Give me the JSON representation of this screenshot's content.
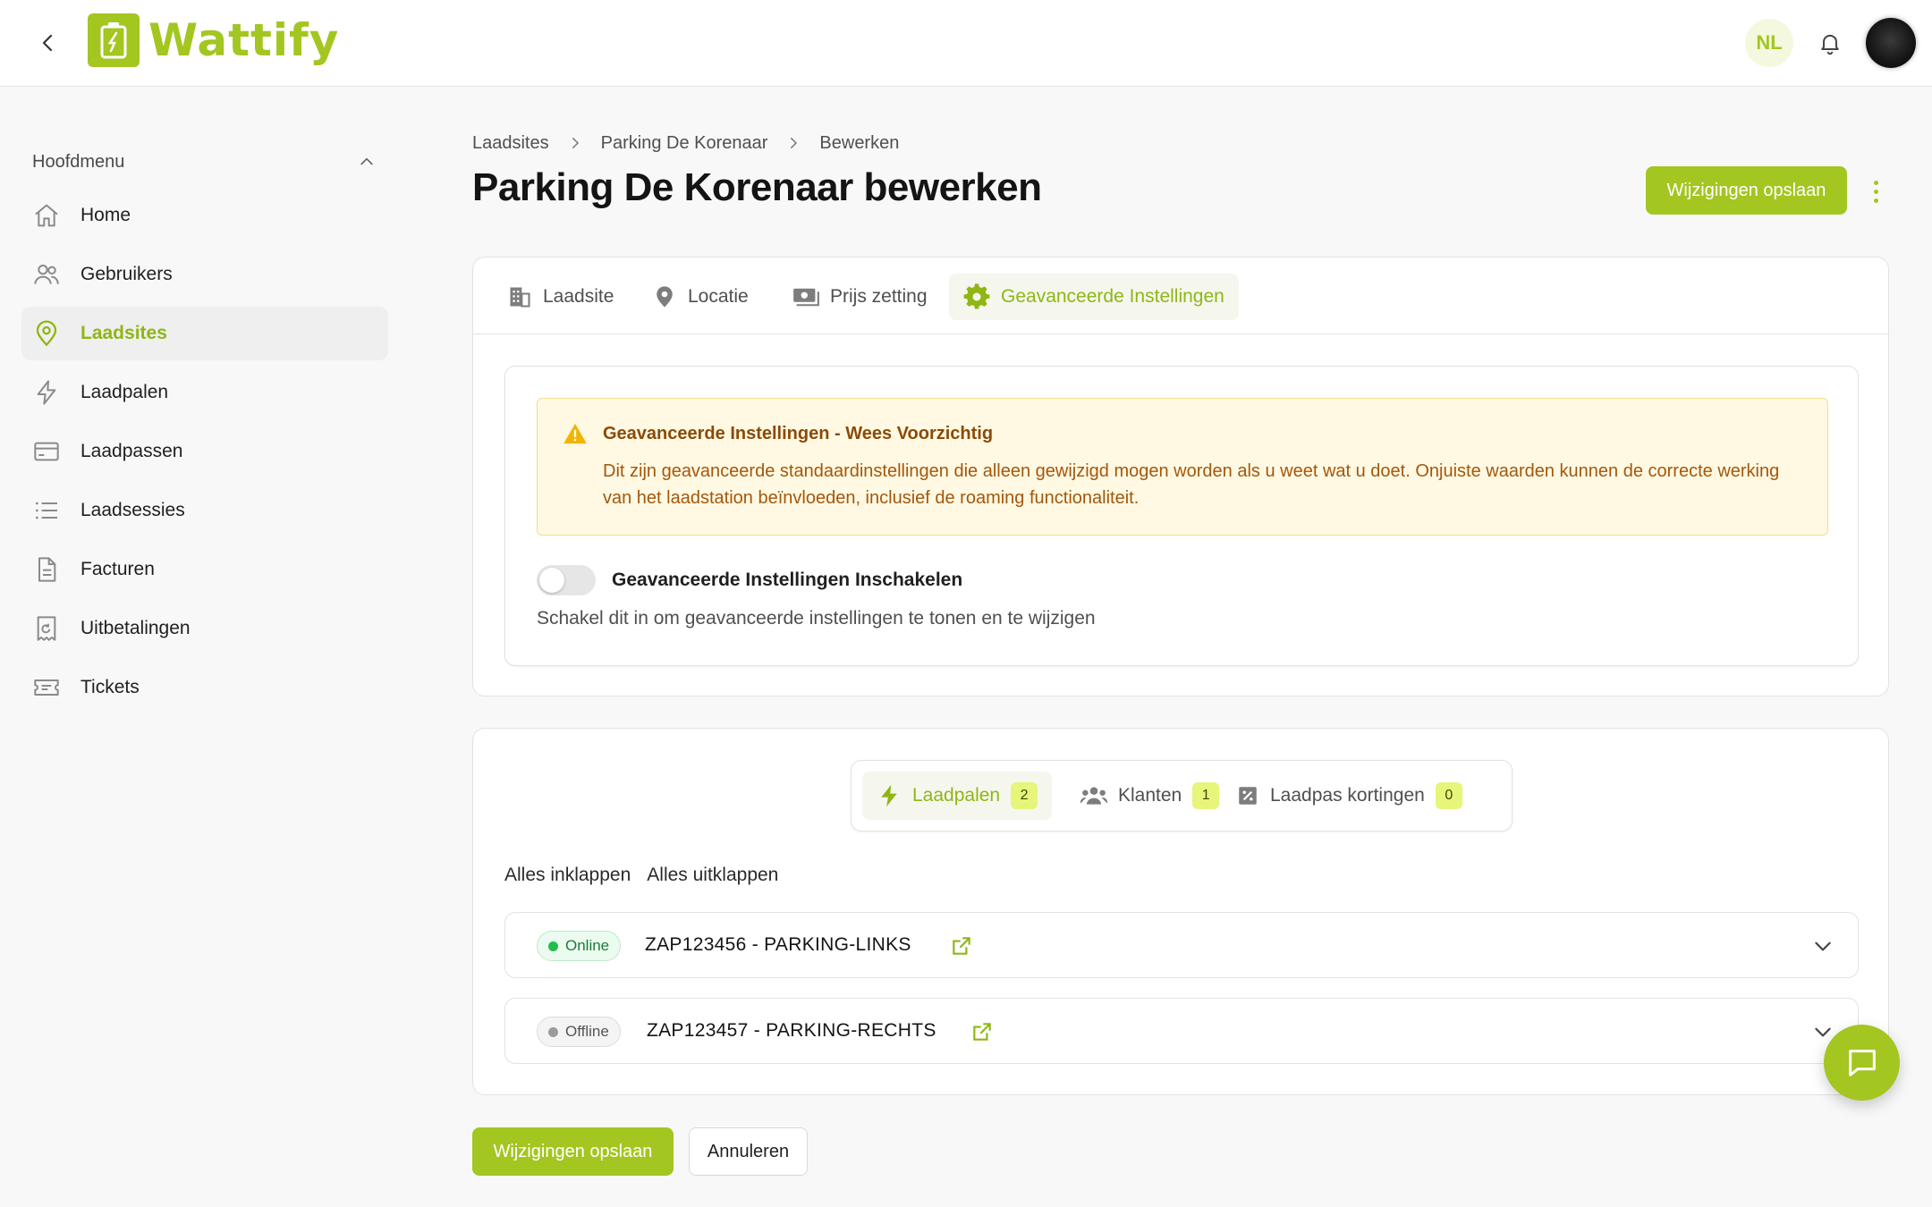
{
  "app": {
    "brand": "Wattify",
    "accent_color": "#a3c621"
  },
  "header": {
    "language": "NL",
    "icons": [
      "chevron-left-icon",
      "bell-icon"
    ]
  },
  "sidebar": {
    "section_title": "Hoofdmenu",
    "items": [
      {
        "label": "Home",
        "icon": "home-icon"
      },
      {
        "label": "Gebruikers",
        "icon": "users-icon"
      },
      {
        "label": "Laadsites",
        "icon": "map-pin-icon",
        "active": true
      },
      {
        "label": "Laadpalen",
        "icon": "bolt-icon"
      },
      {
        "label": "Laadpassen",
        "icon": "card-icon"
      },
      {
        "label": "Laadsessies",
        "icon": "list-icon"
      },
      {
        "label": "Facturen",
        "icon": "document-icon"
      },
      {
        "label": "Uitbetalingen",
        "icon": "receipt-icon"
      },
      {
        "label": "Tickets",
        "icon": "ticket-icon"
      }
    ]
  },
  "breadcrumb": [
    "Laadsites",
    "Parking De Korenaar",
    "Bewerken"
  ],
  "page": {
    "title": "Parking De Korenaar bewerken",
    "save_label": "Wijzigingen opslaan",
    "cancel_label": "Annuleren"
  },
  "tabs": [
    {
      "label": "Laadsite",
      "icon": "building-icon"
    },
    {
      "label": "Locatie",
      "icon": "location-icon"
    },
    {
      "label": "Prijs zetting",
      "icon": "money-icon"
    },
    {
      "label": "Geavanceerde Instellingen",
      "icon": "gear-icon",
      "active": true
    }
  ],
  "advanced": {
    "warning_title": "Geavanceerde Instellingen - Wees Voorzichtig",
    "warning_text": "Dit zijn geavanceerde standaardinstellingen die alleen gewijzigd mogen worden als u weet wat u doet. Onjuiste waarden kunnen de correcte werking van het laadstation beïnvloeden, inclusief de roaming functionaliteit.",
    "toggle_label": "Geavanceerde Instellingen Inschakelen",
    "toggle_help": "Schakel dit in om geavanceerde instellingen te tonen en te wijzigen",
    "toggle_on": false
  },
  "subtabs": [
    {
      "label": "Laadpalen",
      "count": "2",
      "icon": "bolt-icon",
      "active": true
    },
    {
      "label": "Klanten",
      "count": "1",
      "icon": "users-icon"
    },
    {
      "label": "Laadpas kortingen",
      "count": "0",
      "icon": "discount-icon"
    }
  ],
  "collapse_all": "Alles inklappen",
  "expand_all": "Alles uitklappen",
  "chargers": [
    {
      "status": "Online",
      "name": "ZAP123456 - PARKING-LINKS"
    },
    {
      "status": "Offline",
      "name": "ZAP123457 - PARKING-RECHTS"
    }
  ]
}
